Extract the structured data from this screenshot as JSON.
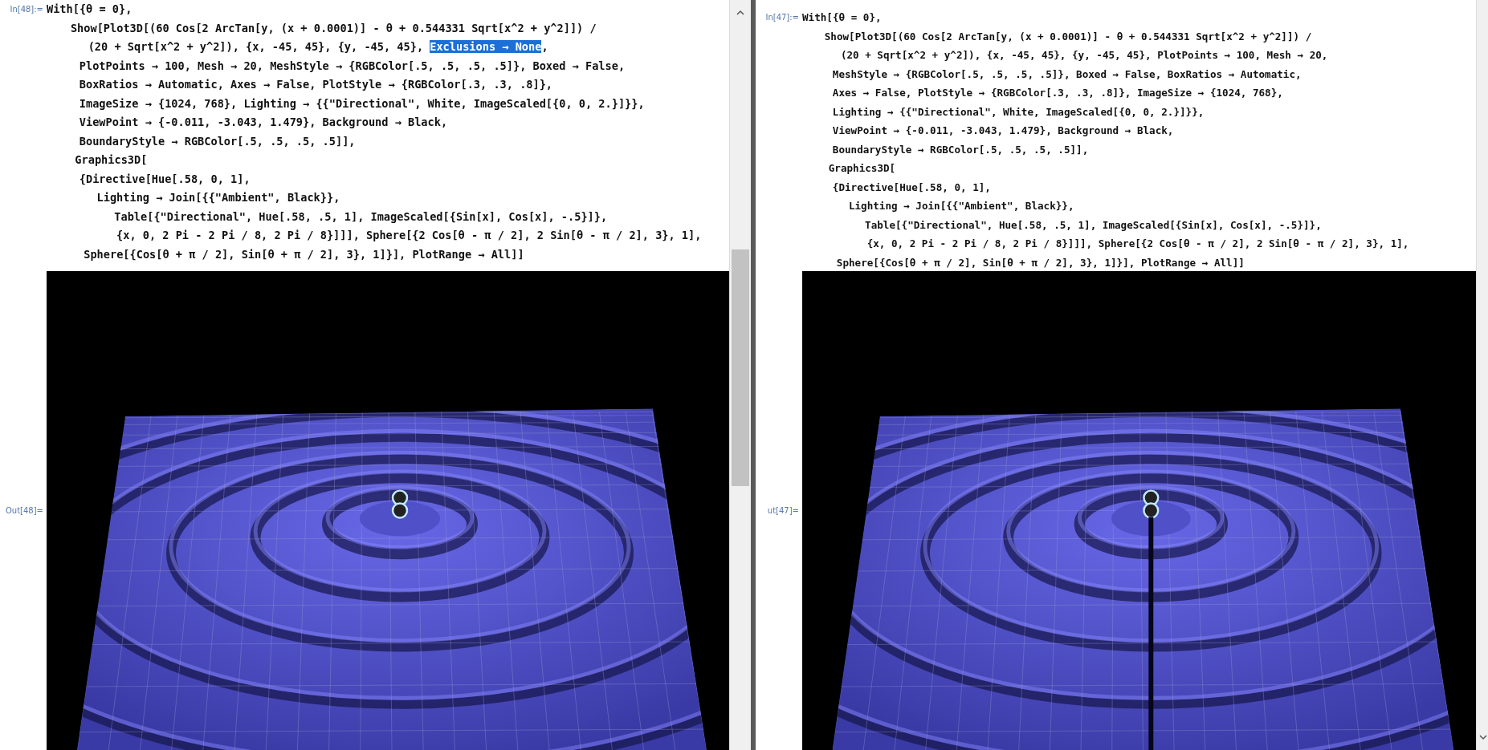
{
  "panes": [
    {
      "input_label": "In[48]:=",
      "output_label": "Out[48]=",
      "seam_visible": false,
      "lines": [
        [
          {
            "text": "With[{θ = 0},",
            "selected": false
          }
        ],
        [
          {
            "text": "Show[Plot3D[(60 Cos[2 ArcTan[y, (x + 0.0001)] - θ + 0.544331 Sqrt[x^2 + y^2]]) /",
            "selected": false
          }
        ],
        [
          {
            "text": "(20 + Sqrt[x^2 + y^2]), {x, -45, 45}, {y, -45, 45}, ",
            "selected": false
          },
          {
            "text": "Exclusions → None",
            "selected": true
          },
          {
            "text": ",",
            "selected": false
          }
        ],
        [
          {
            "text": "PlotPoints → 100, Mesh → 20, MeshStyle → {RGBColor[.5, .5, .5, .5]}, Boxed → False,",
            "selected": false
          }
        ],
        [
          {
            "text": "BoxRatios → Automatic, Axes → False, PlotStyle → {RGBColor[.3, .3, .8]},",
            "selected": false
          }
        ],
        [
          {
            "text": "ImageSize → {1024, 768}, Lighting → {{\"Directional\", White, ImageScaled[{0, 0, 2.}]}},",
            "selected": false
          }
        ],
        [
          {
            "text": "ViewPoint → {-0.011, -3.043, 1.479}, Background → Black,",
            "selected": false
          }
        ],
        [
          {
            "text": "BoundaryStyle → RGBColor[.5, .5, .5, .5]],",
            "selected": false
          }
        ],
        [
          {
            "text": "Graphics3D[",
            "selected": false
          }
        ],
        [
          {
            "text": "{Directive[Hue[.58, 0, 1],",
            "selected": false
          }
        ],
        [
          {
            "text": "Lighting → Join[{{\"Ambient\", Black}},",
            "selected": false
          }
        ],
        [
          {
            "text": "Table[{\"Directional\", Hue[.58, .5, 1], ImageScaled[{Sin[x], Cos[x], -.5}]},",
            "selected": false
          }
        ],
        [
          {
            "text": "{x, 0, 2 Pi - 2 Pi / 8, 2 Pi / 8}]]], Sphere[{2 Cos[θ - π / 2], 2 Sin[θ - π / 2], 3}, 1],",
            "selected": false
          }
        ],
        [
          {
            "text": "Sphere[{Cos[θ + π / 2], Sin[θ + π / 2], 3}, 1]}], PlotRange → All]]",
            "selected": false
          }
        ]
      ]
    },
    {
      "input_label": "In[47]:=",
      "output_label": "ut[47]=",
      "seam_visible": true,
      "lines": [
        [
          {
            "text": "With[{θ = 0},",
            "selected": false
          }
        ],
        [
          {
            "text": "Show[Plot3D[(60 Cos[2 ArcTan[y, (x + 0.0001)] - θ + 0.544331 Sqrt[x^2 + y^2]]) /",
            "selected": false
          }
        ],
        [
          {
            "text": "(20 + Sqrt[x^2 + y^2]), {x, -45, 45}, {y, -45, 45}, PlotPoints → 100, Mesh → 20,",
            "selected": false
          }
        ],
        [
          {
            "text": "MeshStyle → {RGBColor[.5, .5, .5, .5]}, Boxed → False, BoxRatios → Automatic,",
            "selected": false
          }
        ],
        [
          {
            "text": "Axes → False, PlotStyle → {RGBColor[.3, .3, .8]}, ImageSize → {1024, 768},",
            "selected": false
          }
        ],
        [
          {
            "text": "Lighting → {{\"Directional\", White, ImageScaled[{0, 0, 2.}]}},",
            "selected": false
          }
        ],
        [
          {
            "text": "ViewPoint → {-0.011, -3.043, 1.479}, Background → Black,",
            "selected": false
          }
        ],
        [
          {
            "text": "BoundaryStyle → RGBColor[.5, .5, .5, .5]],",
            "selected": false
          }
        ],
        [
          {
            "text": "Graphics3D[",
            "selected": false
          }
        ],
        [
          {
            "text": "{Directive[Hue[.58, 0, 1],",
            "selected": false
          }
        ],
        [
          {
            "text": "Lighting → Join[{{\"Ambient\", Black}},",
            "selected": false
          }
        ],
        [
          {
            "text": "Table[{\"Directional\", Hue[.58, .5, 1], ImageScaled[{Sin[x], Cos[x], -.5}]},",
            "selected": false
          }
        ],
        [
          {
            "text": "{x, 0, 2 Pi - 2 Pi / 8, 2 Pi / 8}]]], Sphere[{2 Cos[θ - π / 2], 2 Sin[θ - π / 2], 3}, 1],",
            "selected": false
          }
        ],
        [
          {
            "text": "Sphere[{Cos[θ + π / 2], Sin[θ + π / 2], 3}, 1]}], PlotRange → All]]",
            "selected": false
          }
        ]
      ]
    }
  ]
}
